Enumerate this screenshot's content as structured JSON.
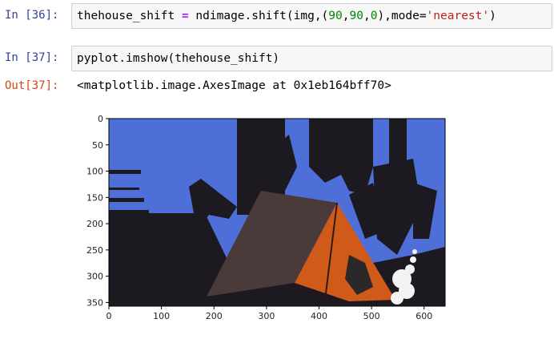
{
  "cells": [
    {
      "prompt": "In [36]:",
      "code": {
        "var": "thehouse_shift",
        "op": " = ",
        "call": "ndimage.shift(img,(",
        "n1": "90",
        "c1": ",",
        "n2": "90",
        "c2": ",",
        "n3": "0",
        "close": "),mode=",
        "str": "'nearest'",
        "end": ")"
      }
    },
    {
      "prompt": "In [37]:",
      "code_text": "pyplot.imshow(thehouse_shift)",
      "out_prompt": "Out[37]:",
      "output_text": "<matplotlib.image.AxesImage at 0x1eb164bff70>"
    }
  ],
  "plot": {
    "x_ticks": [
      "0",
      "100",
      "200",
      "300",
      "400",
      "500",
      "600"
    ],
    "y_ticks": [
      "0",
      "50",
      "100",
      "150",
      "200",
      "250",
      "300",
      "350"
    ],
    "colors": {
      "sky": "#4f6fd8",
      "dark": "#1c1a20",
      "tent_dark": "#4a3a3a",
      "tent_orange": "#d05a1a",
      "smoke": "#f2f2f2"
    }
  }
}
